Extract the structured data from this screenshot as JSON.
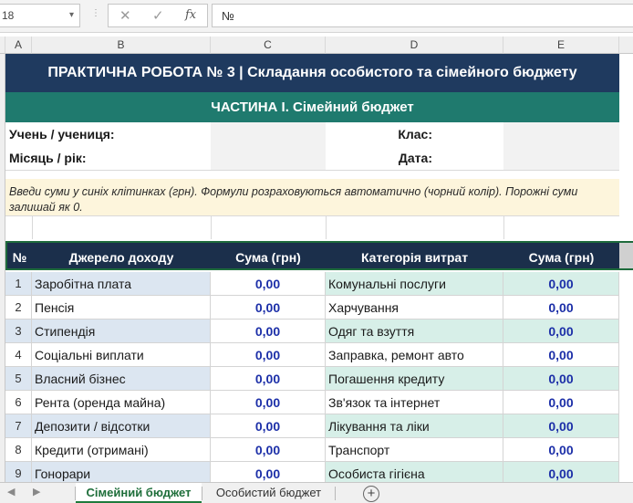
{
  "formula_bar": {
    "name_box": "18",
    "cancel_icon": "✕",
    "enter_icon": "✓",
    "fx_label": "fx",
    "formula_value": "№"
  },
  "columns": [
    "A",
    "B",
    "C",
    "D",
    "E"
  ],
  "sheet": {
    "title": "ПРАКТИЧНА РОБОТА № 3  |  Складання особистого та сімейного бюджету",
    "part": "ЧАСТИНА І.  Сімейний бюджет",
    "student_label": "Учень / учениця:",
    "month_label": "Місяць / рік:",
    "class_label": "Клас:",
    "date_label": "Дата:",
    "note": "Введи суми у синіх клітинках (грн). Формули розраховуються автоматично (чорний колір). Порожні суми залишай як 0.",
    "headers": {
      "num": "№",
      "income_source": "Джерело доходу",
      "income_sum": "Сума (грн)",
      "expense_category": "Категорія витрат",
      "expense_sum": "Сума (грн)"
    },
    "rows": [
      {
        "n": "1",
        "income": "Заробітна плата",
        "income_sum": "0,00",
        "expense": "Комунальні послуги",
        "expense_sum": "0,00"
      },
      {
        "n": "2",
        "income": "Пенсія",
        "income_sum": "0,00",
        "expense": "Харчування",
        "expense_sum": "0,00"
      },
      {
        "n": "3",
        "income": "Стипендія",
        "income_sum": "0,00",
        "expense": "Одяг та взуття",
        "expense_sum": "0,00"
      },
      {
        "n": "4",
        "income": "Соціальні виплати",
        "income_sum": "0,00",
        "expense": "Заправка, ремонт авто",
        "expense_sum": "0,00"
      },
      {
        "n": "5",
        "income": "Власний бізнес",
        "income_sum": "0,00",
        "expense": "Погашення кредиту",
        "expense_sum": "0,00"
      },
      {
        "n": "6",
        "income": "Рента (оренда майна)",
        "income_sum": "0,00",
        "expense": "Зв'язок та інтернет",
        "expense_sum": "0,00"
      },
      {
        "n": "7",
        "income": "Депозити / відсотки",
        "income_sum": "0,00",
        "expense": "Лікування та ліки",
        "expense_sum": "0,00"
      },
      {
        "n": "8",
        "income": "Кредити (отримані)",
        "income_sum": "0,00",
        "expense": "Транспорт",
        "expense_sum": "0,00"
      },
      {
        "n": "9",
        "income": "Гонорари",
        "income_sum": "0,00",
        "expense": "Особиста гігієна",
        "expense_sum": "0,00"
      }
    ]
  },
  "tabs": {
    "active": "Сімейний бюджет",
    "inactive": "Особистий бюджет",
    "add_icon": "+"
  },
  "colors": {
    "title_bg": "#1f3a5f",
    "part_bg": "#1f7a6e",
    "header_bg": "#1b2f4b",
    "income_bg": "#dce6f1",
    "expense_bg": "#d7efe8",
    "input_blue": "#1c2fa8",
    "active_tab": "#1e7a3c"
  }
}
